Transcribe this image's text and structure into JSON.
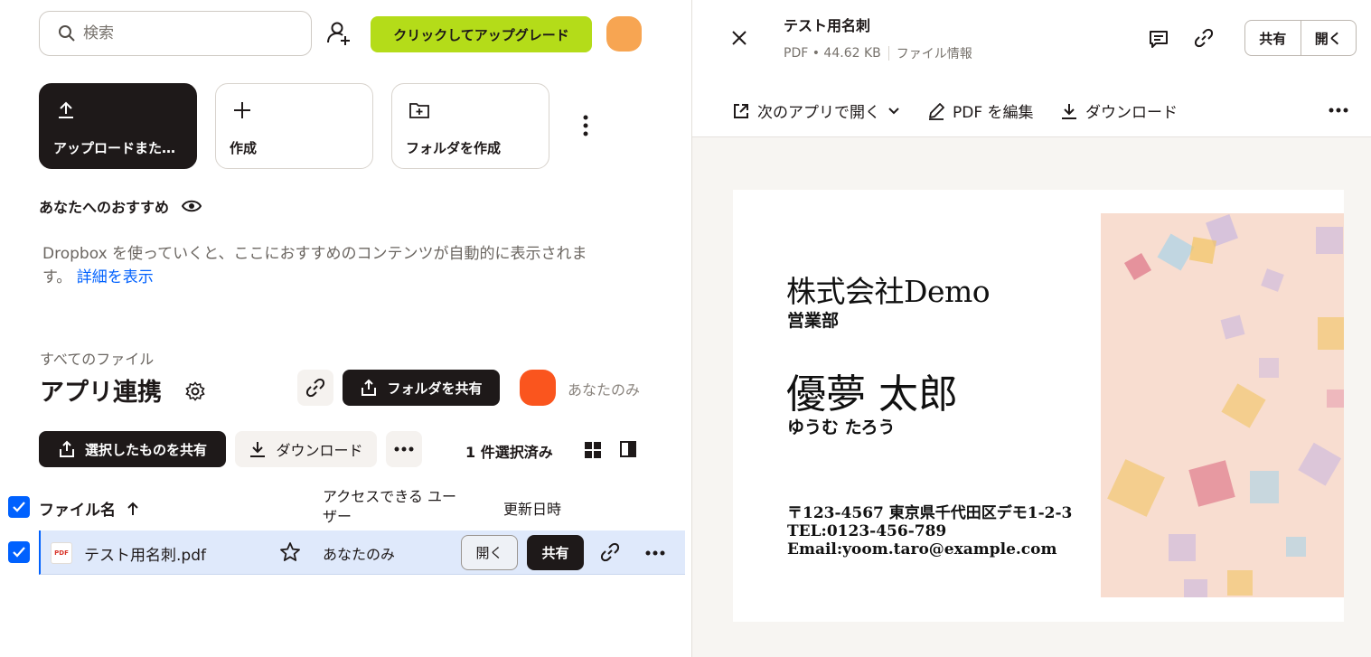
{
  "search": {
    "placeholder": "検索"
  },
  "header": {
    "upgrade_label": "クリックしてアップグレード"
  },
  "actions": {
    "upload_label": "アップロードまた…",
    "create_label": "作成",
    "create_folder_label": "フォルダを作成"
  },
  "recommend": {
    "title": "あなたへのおすすめ",
    "body": "Dropbox を使っていくと、ここにおすすめのコンテンツが自動的に表示されます。",
    "link": "詳細を表示"
  },
  "folder": {
    "breadcrumb": "すべてのファイル",
    "title": "アプリ連携",
    "share_folder_label": "フォルダを共有",
    "members_label": "あなたのみ"
  },
  "toolbar": {
    "share_selected_label": "選択したものを共有",
    "download_label": "ダウンロード",
    "selected_count": "1 件選択済み"
  },
  "table": {
    "columns": {
      "name": "ファイル名",
      "access": "アクセスできる ユーザー",
      "modified": "更新日時"
    },
    "rows": [
      {
        "icon_text": "PDF",
        "name": "テスト用名刺.pdf",
        "access": "あなたのみ",
        "open_label": "開く",
        "share_label": "共有"
      }
    ]
  },
  "preview": {
    "title": "テスト用名刺",
    "meta": "PDF • 44.62 KB",
    "file_info": "ファイル情報",
    "share_label": "共有",
    "open_label": "開く",
    "open_with_label": "次のアプリで開く",
    "edit_pdf_label": "PDF を編集",
    "download_label": "ダウンロード",
    "card": {
      "company": "株式会社Demo",
      "department": "営業部",
      "name": "優夢 太郎",
      "kana": "ゆうむ たろう",
      "address": "〒123-4567 東京県千代田区デモ1-2-3",
      "tel": "TEL:0123-456-789",
      "email": "Email:yoom.taro@example.com"
    }
  },
  "colors": {
    "accent_blue": "#0061fe",
    "upgrade_green": "#b4dc19",
    "dark": "#1e1919",
    "avatar_orange": "#f7a552",
    "avatar_red_orange": "#fa551e"
  }
}
